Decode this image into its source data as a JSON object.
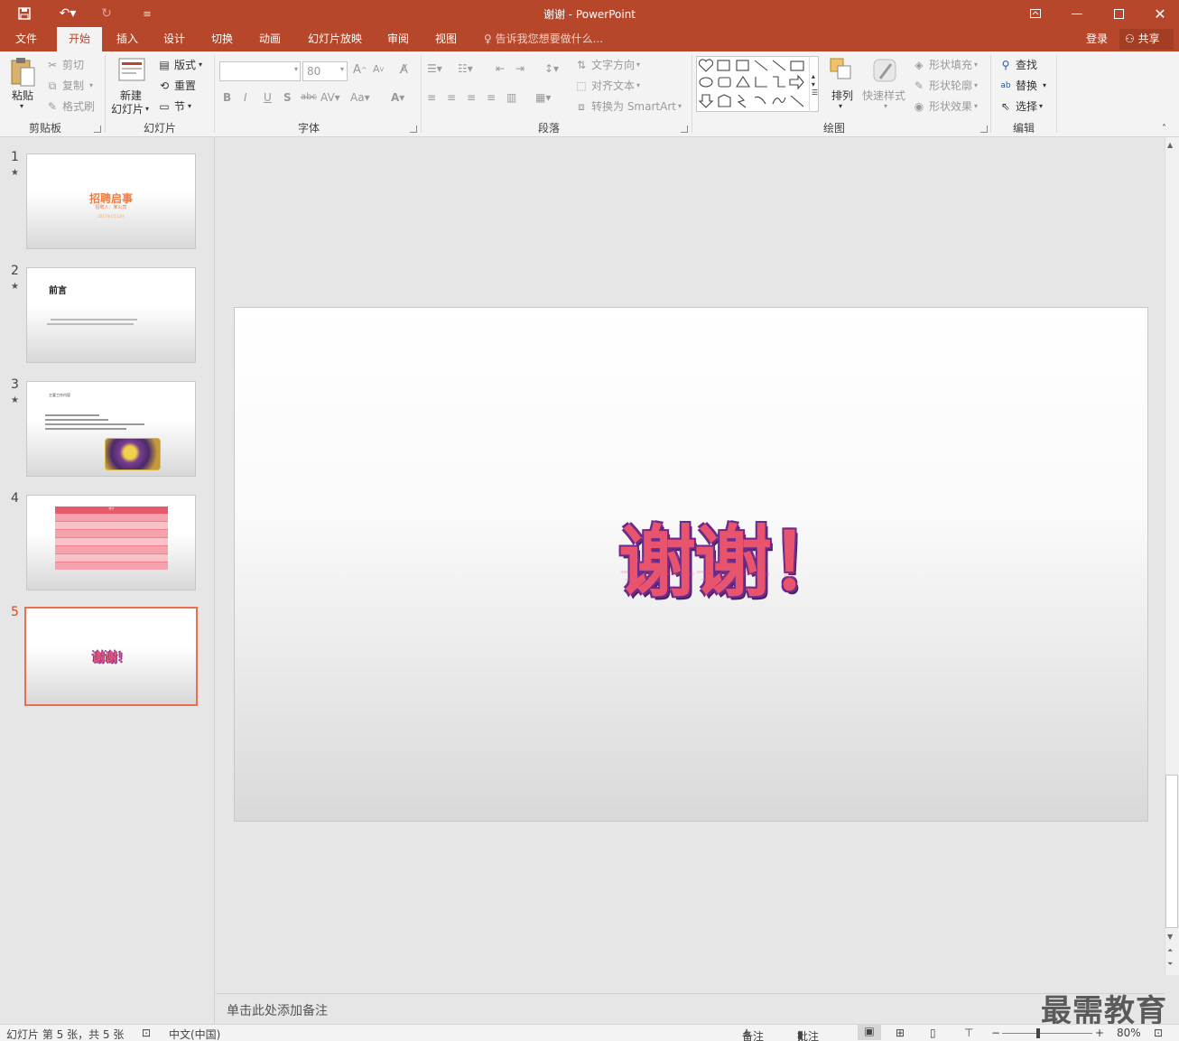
{
  "titlebar": {
    "title": "谢谢 - PowerPoint",
    "bg_color": "#b7472a"
  },
  "tabs": [
    {
      "label": "文件"
    },
    {
      "label": "开始",
      "active": true
    },
    {
      "label": "插入"
    },
    {
      "label": "设计"
    },
    {
      "label": "切换"
    },
    {
      "label": "动画"
    },
    {
      "label": "幻灯片放映"
    },
    {
      "label": "审阅"
    },
    {
      "label": "视图"
    }
  ],
  "tellme": "告诉我您想要做什么...",
  "account": {
    "login": "登录",
    "share": "共享"
  },
  "ribbon": {
    "clipboard": {
      "paste": "粘贴",
      "cut": "剪切",
      "copy": "复制",
      "format_painter": "格式刷",
      "label": "剪贴板"
    },
    "slides": {
      "new_slide_l1": "新建",
      "new_slide_l2": "幻灯片",
      "layout": "版式",
      "reset": "重置",
      "section": "节",
      "label": "幻灯片"
    },
    "font": {
      "font_size": "80",
      "label": "字体"
    },
    "paragraph": {
      "text_direction": "文字方向",
      "align_text": "对齐文本",
      "smartart": "转换为 SmartArt",
      "label": "段落"
    },
    "drawing": {
      "arrange": "排列",
      "quick_styles": "快速样式",
      "shape_fill": "形状填充",
      "shape_outline": "形状轮廓",
      "shape_effects": "形状效果",
      "label": "绘图"
    },
    "editing": {
      "find": "查找",
      "replace": "替换",
      "select": "选择",
      "label": "编辑"
    }
  },
  "slides": [
    {
      "number": "1",
      "has_animation": true,
      "title": "招聘启事",
      "subtitle": "招聘人：某公司",
      "date": "2017年1月12日"
    },
    {
      "number": "2",
      "has_animation": true,
      "title": "前言"
    },
    {
      "number": "3",
      "has_animation": true,
      "heading": "主要工作内容"
    },
    {
      "number": "4",
      "has_animation": false,
      "table_title": "统计"
    },
    {
      "number": "5",
      "has_animation": false,
      "text": "谢谢！",
      "selected": true
    }
  ],
  "current_slide": {
    "text": "谢谢！"
  },
  "notes_placeholder": "单击此处添加备注",
  "watermark": "最需教育",
  "status": {
    "slide_info": "幻灯片 第 5 张，共 5 张",
    "language": "中文(中国)",
    "notes": "备注",
    "comments": "批注",
    "zoom": "80%"
  },
  "colors": {
    "accent": "#d24726",
    "thanks_fill": "#e8546e",
    "thanks_outline": "#6b2a8c"
  }
}
